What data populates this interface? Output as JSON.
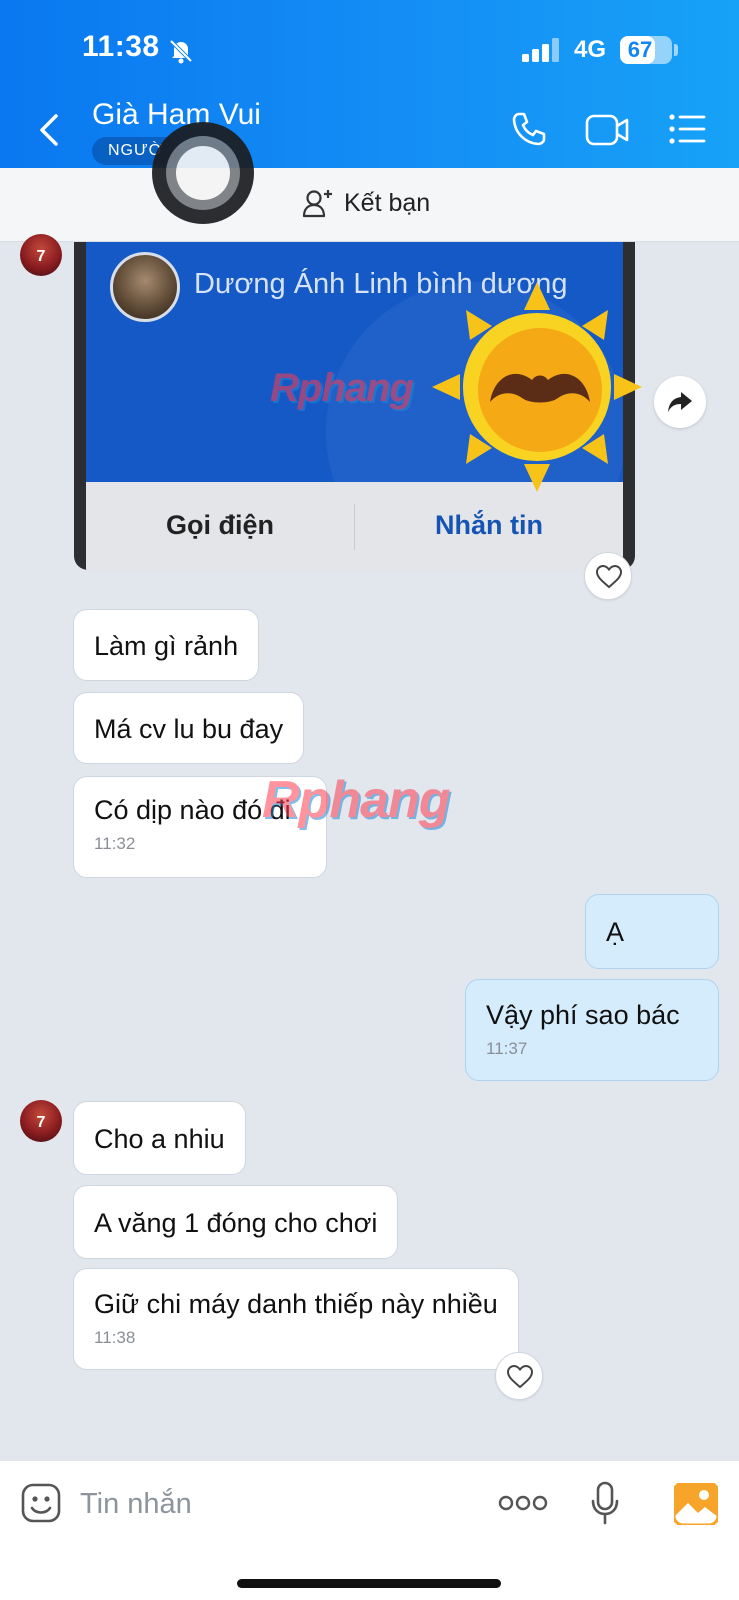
{
  "status_bar": {
    "time": "11:38",
    "network": "4G",
    "battery_level": "67",
    "battery_fraction": 0.67,
    "icons": [
      "bell-off-icon",
      "signal-icon",
      "battery-icon"
    ]
  },
  "header": {
    "contact_name": "Già Ham Vui",
    "badge": "NGƯỜ",
    "icons": [
      "back-icon",
      "phone-icon",
      "video-call-icon",
      "menu-list-icon"
    ],
    "accent_color": "#1186f2"
  },
  "friend_bar": {
    "label": "Kết bạn"
  },
  "card": {
    "name": "Dương Ánh Linh bình dương",
    "call_label": "Gọi điện",
    "message_label": "Nhắn tin"
  },
  "watermark": {
    "text_red": "Rphang",
    "text_blue": "ng"
  },
  "messages": {
    "m1": "Làm gì rảnh",
    "m2": "Má cv lu bu đay",
    "m3": "Có dịp nào đó đi",
    "m3_time": "11:32",
    "m4": "Ạ",
    "m5": "Vậy phí sao bác",
    "m5_time": "11:37",
    "m6": "Cho a nhiu",
    "m7": "A văng 1 đóng cho chơi",
    "m8": "Giữ chi máy danh thiếp này nhiều",
    "m8_time": "11:38"
  },
  "avatar_text": "7",
  "input": {
    "placeholder": "Tin nhắn"
  }
}
